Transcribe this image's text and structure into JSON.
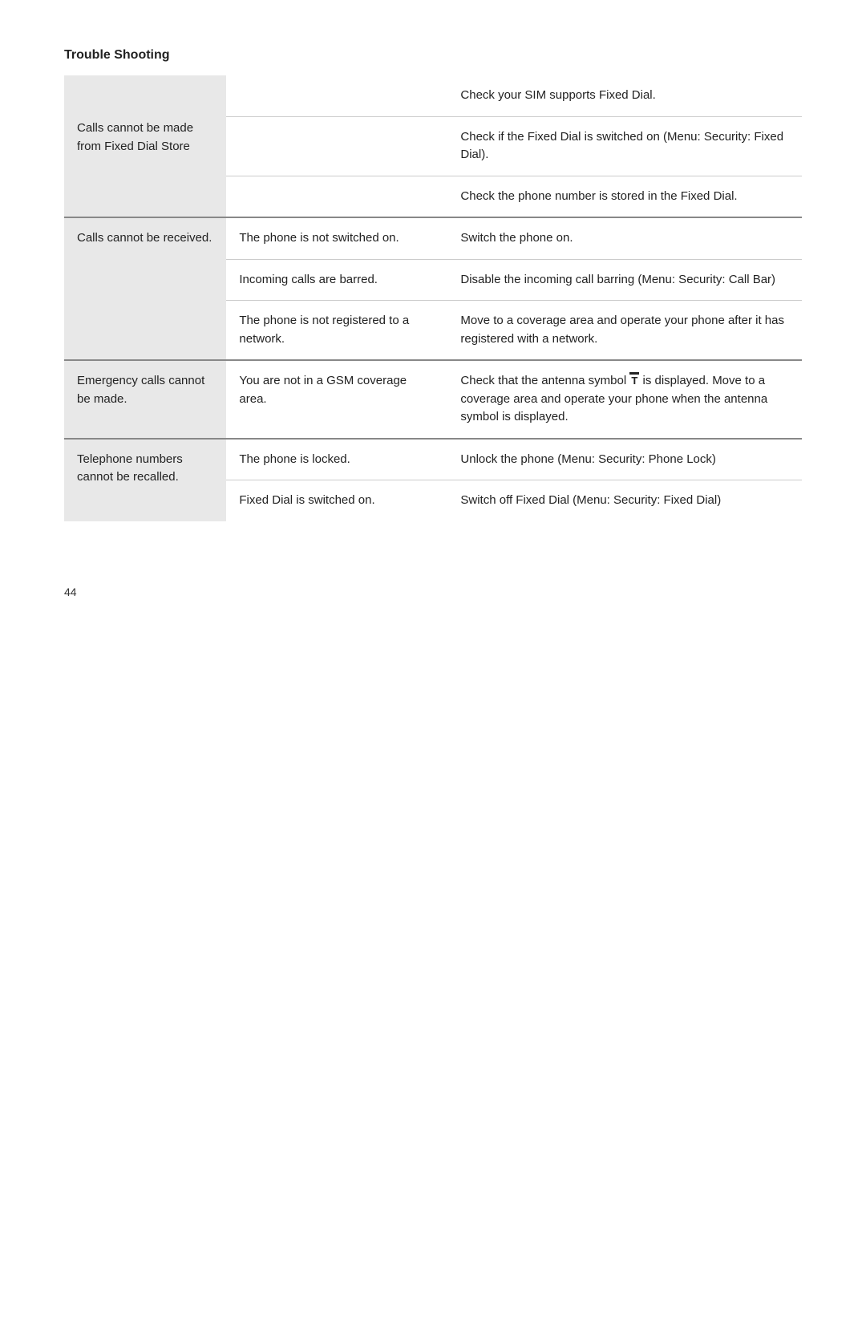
{
  "page": {
    "title": "Trouble Shooting",
    "page_number": "44"
  },
  "table": {
    "rows": [
      {
        "problem": "Calls cannot be made from Fixed Dial Store",
        "causes": [
          {
            "cause": "",
            "solution": "Check your SIM supports Fixed Dial."
          },
          {
            "cause": "",
            "solution": "Check if the Fixed Dial is switched on (Menu: Security: Fixed Dial)."
          },
          {
            "cause": "",
            "solution": "Check the phone number is stored in the Fixed Dial."
          }
        ]
      },
      {
        "problem": "Calls cannot be received.",
        "causes": [
          {
            "cause": "The phone is not switched on.",
            "solution": "Switch the phone on."
          },
          {
            "cause": "Incoming calls are barred.",
            "solution": "Disable the incoming call barring (Menu: Security: Call Bar)"
          },
          {
            "cause": "The phone is not registered to a network.",
            "solution": "Move to a coverage area and operate your phone after it has registered with a network."
          }
        ]
      },
      {
        "problem": "Emergency calls cannot be made.",
        "causes": [
          {
            "cause": "You are not in a GSM coverage area.",
            "solution": "Check that the antenna symbol is displayed. Move to a coverage area and operate your phone when the antenna symbol is displayed."
          }
        ]
      },
      {
        "problem": "Telephone numbers cannot be recalled.",
        "causes": [
          {
            "cause": "The phone is locked.",
            "solution": "Unlock the phone (Menu: Security: Phone Lock)"
          },
          {
            "cause": "Fixed Dial is switched on.",
            "solution": "Switch off Fixed Dial (Menu: Security: Fixed Dial)"
          }
        ]
      }
    ]
  }
}
